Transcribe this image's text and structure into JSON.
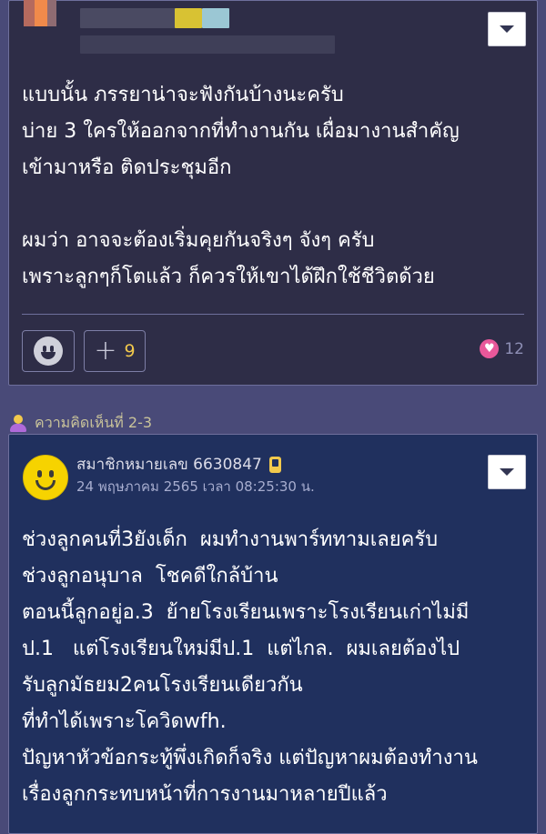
{
  "comment1": {
    "body": "แบบนั้น ภรรยาน่าจะฟังกันบ้างนะครับ\nบ่าย 3 ใครให้ออกจากที่ทำงานกัน เผื่อมางานสำคัญ\nเข้ามาหรือ ติดประชุมอีก\n\nผมว่า อาจจะต้องเริ่มคุยกันจริงๆ จังๆ ครับ\nเพราะลูกๆก็โตแล้ว ก็ควรให้เขาได้ฝึกใช้ชีวิตด้วย",
    "plus_count": "9",
    "like_count": "12"
  },
  "section": {
    "heading": "ความคิดเห็นที่ 2-3"
  },
  "comment2": {
    "author": "สมาชิกหมายเลข 6630847",
    "date": "24 พฤษภาคม 2565 เวลา 08:25:30 น.",
    "body": "ช่วงลูกคนที่3ยังเด็ก  ผมทำงานพาร์ททามเลยครับ\nช่วงลูกอนุบาล  โชคดีใกล้บ้าน\nตอนนี้ลูกอยู่อ.3  ย้ายโรงเรียนเพราะโรงเรียนเก่าไม่มี\nป.1   แต่โรงเรียนใหม่มีป.1  แต่ไกล.  ผมเลยต้องไป\nรับลูกมัธยม2คนโรงเรียนเดียวกัน\nที่ทำได้เพราะโควิดwfh.\nปัญหาหัวข้อกระทู้พึ่งเกิดก็จริง แต่ปัญหาผมต้องทำงาน\nเรื่องลูกกระทบหน้าที่การงานมาหลายปีแล้ว"
  },
  "colors": {
    "page_bg": "#494a78",
    "card1_bg": "#2e2d47",
    "card2_bg": "#20305e",
    "accent_yellow": "#f2c94c",
    "heart_pink": "#e8589a"
  },
  "icons": [
    "dropdown-chevron-icon",
    "smile-emoji-icon",
    "plus-icon",
    "heart-icon",
    "person-icon",
    "smiley-avatar-icon",
    "phone-icon"
  ]
}
